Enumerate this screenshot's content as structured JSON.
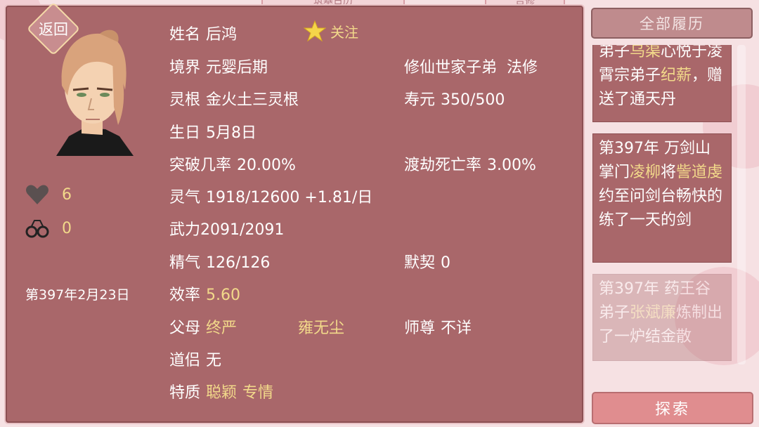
{
  "top_tabs": [
    "筑基日历",
    "吉修"
  ],
  "back_label": "返回",
  "follow_label": "关注",
  "stats": {
    "hearts": "6",
    "handcuffs": "0"
  },
  "game_date": "第397年2月23日",
  "profile": {
    "name_label": "姓名",
    "name": "后鸿",
    "realm_label": "境界",
    "realm": "元婴后期",
    "identity": "修仙世家子弟",
    "school": "法修",
    "root_label": "灵根",
    "root": "金火土三灵根",
    "lifespan_label": "寿元",
    "lifespan": "350/500",
    "birthday_label": "生日",
    "birthday": "5月8日",
    "breakthrough_label": "突破几率",
    "breakthrough": "20.00%",
    "tribulation_label": "渡劫死亡率",
    "tribulation": "3.00%",
    "qi_label": "灵气",
    "qi": "1918/12600 +1.81/日",
    "force_label": "武力",
    "force": "2091/2091",
    "essence_label": "精气",
    "essence": "126/126",
    "tacit_label": "默契",
    "tacit": "0",
    "efficiency_label": "效率",
    "efficiency": "5.60",
    "parents_label": "父母",
    "parent1": "终严",
    "parent2": "雍无尘",
    "master_label": "师尊",
    "master": "不详",
    "partner_label": "道侣",
    "partner": "无",
    "traits_label": "特质",
    "trait1": "聪颖",
    "trait2": "专情"
  },
  "history_button": "全部履历",
  "explore_button": "探索",
  "logs": [
    {
      "p1": "弟子",
      "h1": "乌渠",
      "p2": "心悦于凌霄宗弟子",
      "h2": "纪薪",
      "p3": "，赠送了通天丹"
    },
    {
      "p1": "第397年 万剑山掌门",
      "h1": "凌柳",
      "p2": "将",
      "h2": "訾道虔",
      "p3": "约至问剑台畅快的练了一天的剑"
    },
    {
      "p1": "第397年 药王谷弟子",
      "h1": "张斌廉",
      "p2": "炼制出了一炉结金散",
      "h2": "",
      "p3": ""
    }
  ],
  "colors": {
    "panel": "#a9676a",
    "gold": "#f2d98a",
    "background": "#f6e1e3",
    "accent_button": "#e08d8f"
  }
}
